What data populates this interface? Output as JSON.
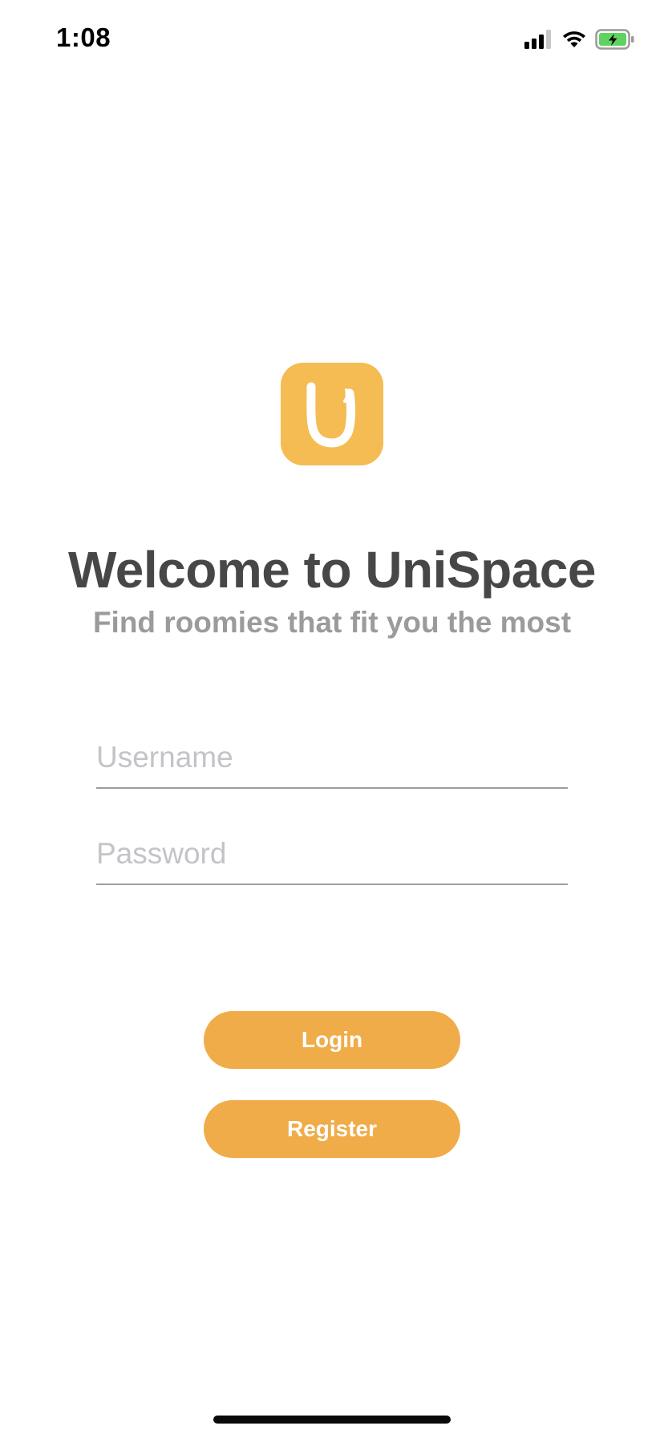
{
  "status_bar": {
    "time": "1:08",
    "icons": [
      "cellular-signal-icon",
      "wifi-icon",
      "battery-charging-icon"
    ]
  },
  "app": {
    "logo_icon": "unispace-u-logo-icon",
    "title": "Welcome to UniSpace",
    "subtitle": "Find roomies that fit you the most"
  },
  "form": {
    "username_placeholder": "Username",
    "username_value": "",
    "password_placeholder": "Password",
    "password_value": ""
  },
  "actions": {
    "login_label": "Login",
    "register_label": "Register"
  },
  "colors": {
    "accent": "#f0ac48",
    "logo_background": "#f4bc52",
    "title_text": "#474747",
    "subtitle_text": "#9b9b9b",
    "placeholder_text": "#c4c4c8",
    "battery_fill": "#5fd35f"
  }
}
